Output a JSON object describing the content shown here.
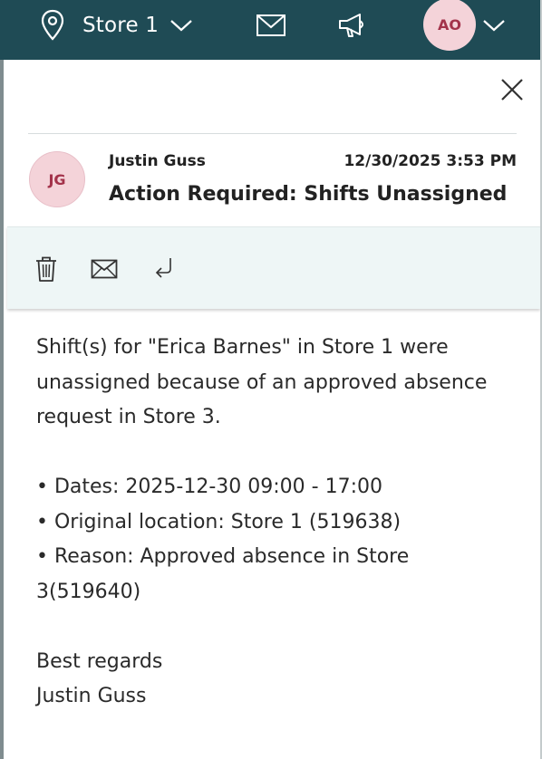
{
  "topbar": {
    "store_label": "Store 1",
    "user_initials": "AO",
    "icons": [
      "location-pin-icon",
      "chevron-down-icon",
      "mail-icon",
      "megaphone-icon",
      "chevron-down-icon"
    ]
  },
  "message": {
    "sender_initials": "JG",
    "sender_name": "Justin Guss",
    "timestamp": "12/30/2025 3:53 PM",
    "subject": "Action Required: Shifts Unassigned",
    "toolbar_icons": [
      "trash-icon",
      "mail-icon",
      "reply-icon"
    ],
    "body": {
      "intro": "Shift(s) for \"Erica Barnes\" in Store 1 were unassigned because of an approved absence request in Store 3.",
      "bullets": [
        "• Dates: 2025-12-30 09:00 - 17:00",
        "• Original location: Store 1 (519638)",
        "• Reason: Approved absence in Store 3(519640)"
      ],
      "closing": "Best regards",
      "signature": "Justin Guss"
    }
  },
  "colors": {
    "topbar_bg": "#1f4b55",
    "avatar_bg": "#f4d3d9",
    "avatar_text": "#a3324a",
    "toolbar_bg": "#eef6f6"
  }
}
